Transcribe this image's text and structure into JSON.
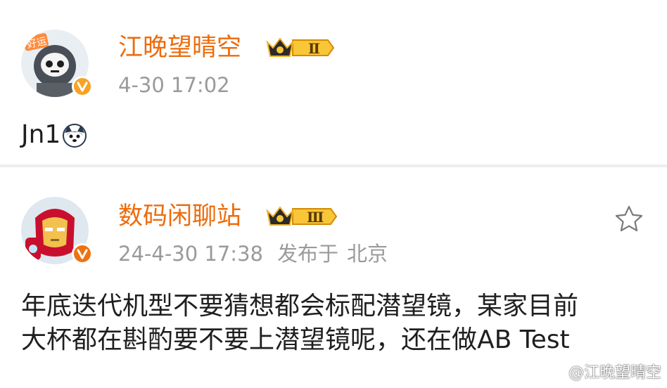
{
  "posts": [
    {
      "username": "江晚望晴空",
      "level_badge": "Ⅱ",
      "time": "4-30 17:02",
      "location_prefix": "",
      "location": "",
      "content": "Jn1",
      "emoji": "husky-dog-emoji",
      "avatar": "lucky-robot-avatar",
      "verified_color": "#f7a325"
    },
    {
      "username": "数码闲聊站",
      "level_badge": "Ⅲ",
      "time": "24-4-30 17:38",
      "location_prefix": "发布于",
      "location": "北京",
      "content_lines": [
        "年底迭代机型不要猜想都会标配潜望镜，某家目前",
        "大杯都在斟酌要不要上潜望镜呢，还在做AB Test"
      ],
      "avatar": "iron-man-avatar",
      "verified_color": "#ee7211"
    }
  ],
  "watermark": "@江晚望晴空",
  "colors": {
    "username": "#ec6c0c",
    "meta": "#9a9a9a",
    "text": "#1f1f1f",
    "divider": "#eeeeee"
  }
}
